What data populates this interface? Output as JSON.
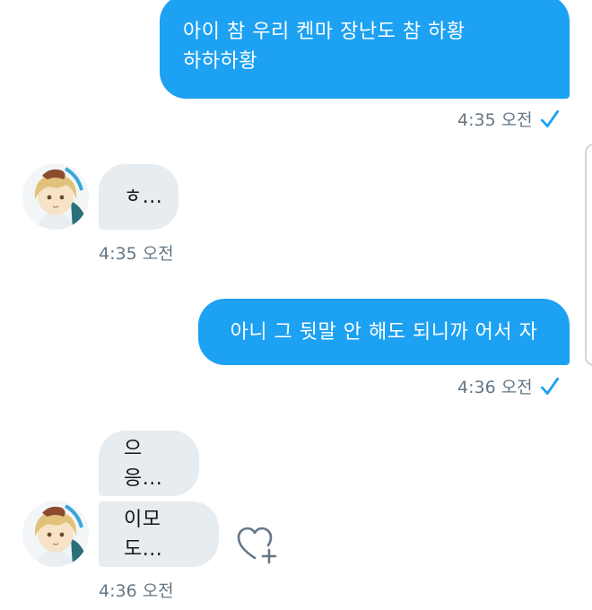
{
  "messages": [
    {
      "id": "m1",
      "direction": "out",
      "lines": [
        "아이 참 우리 켄마 장난도 참 하황",
        "하하하황"
      ],
      "time": "4:35 오전",
      "status_icon": "sent-check-icon"
    },
    {
      "id": "m2",
      "direction": "in",
      "text": "ㅎ...",
      "time": "4:35 오전"
    },
    {
      "id": "m3",
      "direction": "out",
      "text": "아니 그 뒷말 안 해도 되니까 어서 자",
      "time": "4:36 오전",
      "status_icon": "sent-check-icon"
    },
    {
      "id": "m4",
      "direction": "in",
      "text": "으응...",
      "time": ""
    },
    {
      "id": "m5",
      "direction": "in",
      "text": "이모도...",
      "time": "4:36 오전",
      "reaction_icon": "add-reaction-heart-icon"
    }
  ],
  "colors": {
    "outgoing_bubble": "#1da1f2",
    "incoming_bubble": "#e6ecf0",
    "timestamp_text": "#657786",
    "check_mark": "#1da1f2"
  }
}
